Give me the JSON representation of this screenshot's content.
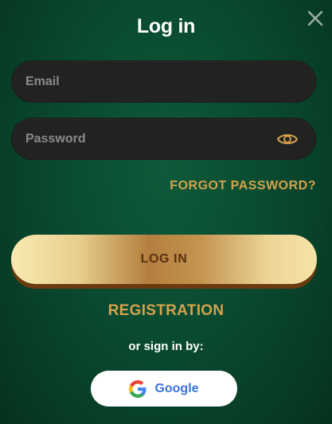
{
  "modal": {
    "title": "Log in",
    "close_icon": "close-icon"
  },
  "form": {
    "email_placeholder": "Email",
    "email_value": "",
    "password_placeholder": "Password",
    "password_value": "",
    "eye_icon": "eye-icon",
    "forgot_label": "FORGOT PASSWORD?",
    "login_label": "LOG IN"
  },
  "registration_label": "REGISTRATION",
  "social": {
    "prompt": "or sign in by:",
    "google_label": "Google",
    "google_icon": "google-icon"
  },
  "colors": {
    "background": "#0a4a30",
    "accent_gold": "#d4a24c",
    "field_bg": "#222222",
    "google_text": "#3b74d9"
  }
}
